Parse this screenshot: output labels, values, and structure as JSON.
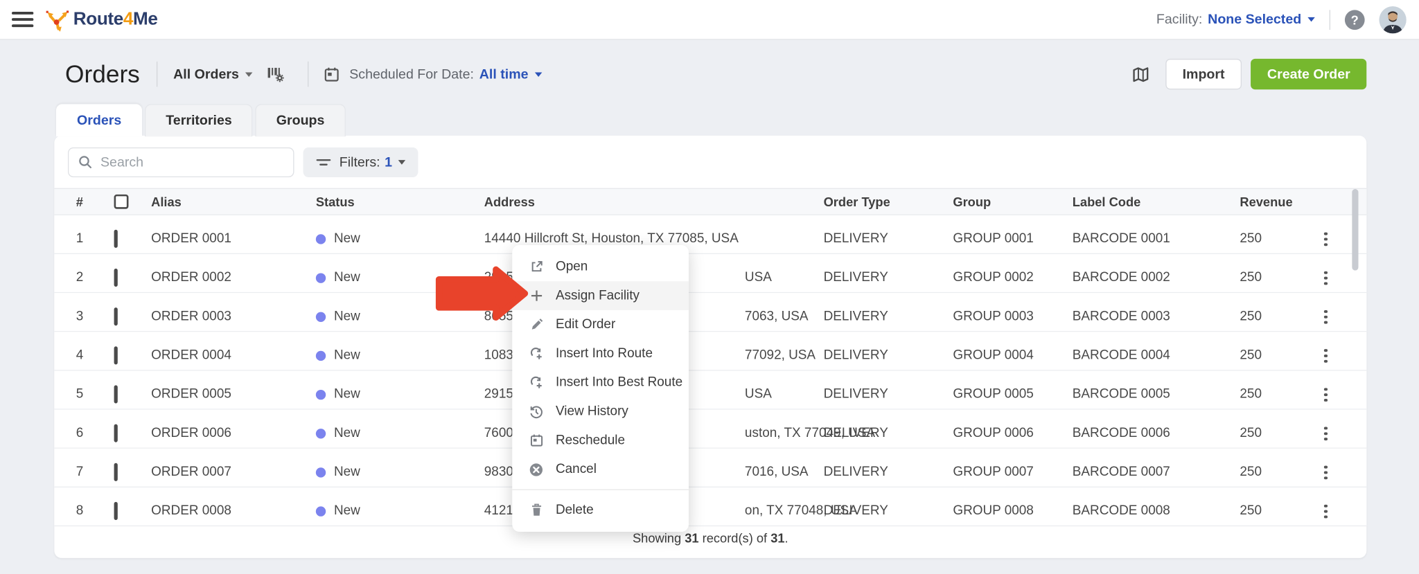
{
  "colors": {
    "accent_blue": "#2a52b8",
    "green_button": "#76b82e",
    "status_new": "#7b83ee",
    "red_arrow": "#e8432b",
    "logo_navy": "#2c3e6b",
    "logo_orange": "#f39c12"
  },
  "topbar": {
    "brand_prefix": "Route",
    "brand_four": "4",
    "brand_suffix": "Me",
    "facility_label": "Facility:",
    "facility_value": "None Selected",
    "help_glyph": "?"
  },
  "header": {
    "title": "Orders",
    "orders_filter": "All Orders",
    "scheduled_label": "Scheduled For Date:",
    "scheduled_value": "All time",
    "import_label": "Import",
    "create_label": "Create Order"
  },
  "tabs": [
    {
      "label": "Orders",
      "active": true
    },
    {
      "label": "Territories",
      "active": false
    },
    {
      "label": "Groups",
      "active": false
    }
  ],
  "toolbar": {
    "search_placeholder": "Search",
    "filters_label": "Filters:",
    "filters_count": "1"
  },
  "table": {
    "columns": {
      "num": "#",
      "alias": "Alias",
      "status": "Status",
      "address": "Address",
      "order_type": "Order Type",
      "group": "Group",
      "label_code": "Label Code",
      "revenue": "Revenue"
    },
    "rows": [
      {
        "num": "1",
        "alias": "ORDER 0001",
        "status": "New",
        "address_left": "14440 Hillcroft St, Houston, TX 77085, USA",
        "address_right": "",
        "order_type": "DELIVERY",
        "group": "GROUP 0001",
        "label_code": "BARCODE 0001",
        "revenue": "250"
      },
      {
        "num": "2",
        "alias": "ORDER 0002",
        "status": "New",
        "address_left": "2915",
        "address_right": "USA",
        "order_type": "DELIVERY",
        "group": "GROUP 0002",
        "label_code": "BARCODE 0002",
        "revenue": "250"
      },
      {
        "num": "3",
        "alias": "ORDER 0003",
        "status": "New",
        "address_left": "8655",
        "address_right": "7063, USA",
        "order_type": "DELIVERY",
        "group": "GROUP 0003",
        "label_code": "BARCODE 0003",
        "revenue": "250"
      },
      {
        "num": "4",
        "alias": "ORDER 0004",
        "status": "New",
        "address_left": "1083",
        "address_right": "77092, USA",
        "order_type": "DELIVERY",
        "group": "GROUP 0004",
        "label_code": "BARCODE 0004",
        "revenue": "250"
      },
      {
        "num": "5",
        "alias": "ORDER 0005",
        "status": "New",
        "address_left": "2915",
        "address_right": "USA",
        "order_type": "DELIVERY",
        "group": "GROUP 0005",
        "label_code": "BARCODE 0005",
        "revenue": "250"
      },
      {
        "num": "6",
        "alias": "ORDER 0006",
        "status": "New",
        "address_left": "7600",
        "address_right": "uston, TX 77049, USA",
        "order_type": "DELIVERY",
        "group": "GROUP 0006",
        "label_code": "BARCODE 0006",
        "revenue": "250"
      },
      {
        "num": "7",
        "alias": "ORDER 0007",
        "status": "New",
        "address_left": "9830",
        "address_right": "7016, USA",
        "order_type": "DELIVERY",
        "group": "GROUP 0007",
        "label_code": "BARCODE 0007",
        "revenue": "250"
      },
      {
        "num": "8",
        "alias": "ORDER 0008",
        "status": "New",
        "address_left": "4121",
        "address_right": "on, TX 77048, USA",
        "order_type": "DELIVERY",
        "group": "GROUP 0008",
        "label_code": "BARCODE 0008",
        "revenue": "250"
      }
    ]
  },
  "context_menu": {
    "items": [
      {
        "icon": "open-icon",
        "label": "Open",
        "highlighted": false
      },
      {
        "icon": "plus-icon",
        "label": "Assign Facility",
        "highlighted": true
      },
      {
        "icon": "pencil-icon",
        "label": "Edit Order",
        "highlighted": false
      },
      {
        "icon": "route-plus-icon",
        "label": "Insert Into Route",
        "highlighted": false
      },
      {
        "icon": "route-plus-icon",
        "label": "Insert Into Best Route",
        "highlighted": false
      },
      {
        "icon": "history-icon",
        "label": "View History",
        "highlighted": false
      },
      {
        "icon": "calendar-icon",
        "label": "Reschedule",
        "highlighted": false
      },
      {
        "icon": "cancel-icon",
        "label": "Cancel",
        "highlighted": false
      },
      {
        "type": "divider"
      },
      {
        "icon": "trash-icon",
        "label": "Delete",
        "highlighted": false
      }
    ]
  },
  "footer": {
    "showing": "Showing",
    "count": "31",
    "of_text": "record(s) of",
    "total": "31",
    "period": "."
  }
}
